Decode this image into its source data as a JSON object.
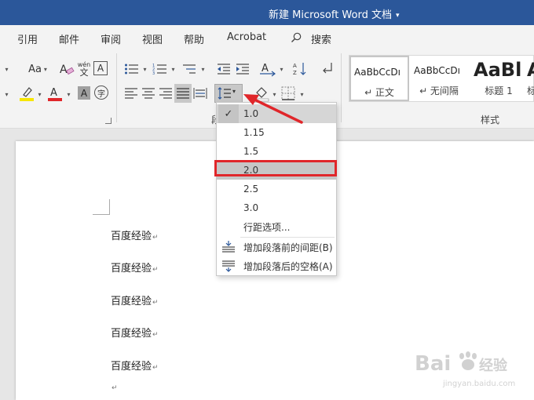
{
  "titlebar": {
    "title": "新建 Microsoft Word 文档",
    "caret": "▾",
    "bg": "#2b579a"
  },
  "menu": {
    "tabs": [
      "引用",
      "邮件",
      "审阅",
      "视图",
      "帮助",
      "Acrobat"
    ],
    "search_label": "搜索"
  },
  "ribbon": {
    "font_size_label": "Aa",
    "pinyin_top": "wén",
    "pinyin_bottom": "文",
    "char_border": "A",
    "font_color": "A",
    "char_shading": "A",
    "enclose_char": "字",
    "paragraph_group_label": "段",
    "styles_group_label": "样式",
    "highlight_color": "#f7e600",
    "font_color_value": "#e0262a"
  },
  "styles": [
    {
      "preview": "AaBbCcDı",
      "name": "↵ 正文"
    },
    {
      "preview": "AaBbCcDı",
      "name": "↵ 无间隔"
    },
    {
      "preview": "AaBl",
      "name": "标题 1"
    },
    {
      "preview": "A",
      "name": "标"
    }
  ],
  "dropdown": {
    "checkmark": "✓",
    "items": [
      "1.0",
      "1.15",
      "1.5",
      "2.0",
      "2.5",
      "3.0"
    ],
    "checked_item": "1.0",
    "selected_item": "2.0",
    "line_spacing_options": "行距选项...",
    "add_space_before": "增加段落前的间距(B)",
    "add_space_after": "增加段落后的空格(A)",
    "annotation_color": "#e0262a"
  },
  "document": {
    "lines": [
      "百度经验",
      "百度经验",
      "百度经验",
      "百度经验",
      "百度经验"
    ],
    "para_mark": "↵"
  },
  "watermark": {
    "brand": "Bai",
    "brand2": "经验",
    "url": "jingyan.baidu.com"
  }
}
